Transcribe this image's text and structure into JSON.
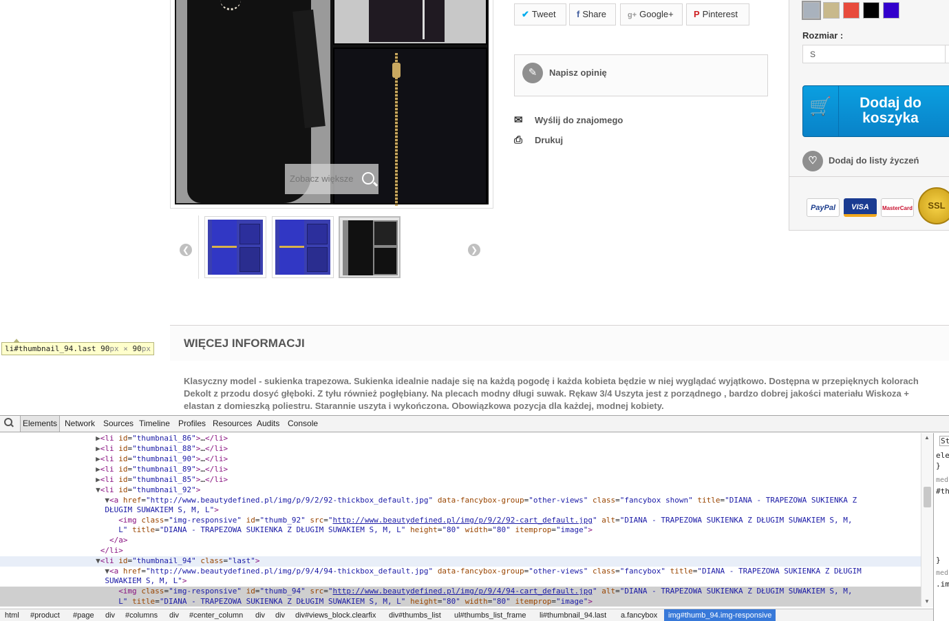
{
  "product": {
    "zoom_label": "Zobacz większe",
    "thumb_prev": "❮",
    "thumb_next": "❯",
    "share": [
      {
        "icon": "twitter-icon",
        "glyph": "🐦",
        "label": "Tweet"
      },
      {
        "icon": "facebook-icon",
        "glyph": "f",
        "label": "Share"
      },
      {
        "icon": "google-plus-icon",
        "glyph": "g+",
        "label": "Google+"
      },
      {
        "icon": "pinterest-icon",
        "glyph": "P",
        "label": "Pinterest"
      }
    ],
    "write_review": "Napisz opinię",
    "send_friend": "Wyślij do znajomego",
    "print": "Drukuj",
    "size_label": "Rozmiar :",
    "size_value": "S",
    "add_to_cart": "Dodaj do koszyka",
    "wishlist": "Dodaj do listy życzeń",
    "swatches": [
      "#a9b2bd",
      "#c8b98c",
      "#e84b3c",
      "#000000",
      "#3300cc"
    ],
    "payment": [
      "PayPal",
      "VISA",
      "MasterCard"
    ],
    "ssl": "SSL",
    "more_info_title": "WIĘCEJ INFORMACJI",
    "description": "Klasyczny model - sukienka trapezowa. Sukienka idealnie nadaje się na każdą pogodę i każda kobieta będzie w niej wyglądać wyjątkowo. Dostępna w przepięknych kolorach\nDekolt z przodu dosyć głęboki. Z tyłu również pogłębiany. Na plecach modny długi suwak. Rękaw 3/4 Uszyta jest z porządnego , bardzo dobrej jakości materiału Wiskoza +\nelastan z domieszką poliestru. Starannie uszyta i wykończona. Obowiązkowa pozycja dla każdej, modnej kobiety."
  },
  "tooltip": {
    "selector": "li#thumbnail_94.last",
    "w": "90",
    "h": "90",
    "unit": "px",
    "times": "×"
  },
  "devtools": {
    "tabs": [
      "Elements",
      "Network",
      "Sources",
      "Timeline",
      "Profiles",
      "Resources",
      "Audits",
      "Console"
    ],
    "breadcrumbs": [
      "html",
      "#product",
      "#page",
      "div",
      "#columns",
      "div",
      "#center_column",
      "div",
      "div",
      "div#views_block.clearfix",
      "div#thumbs_list",
      "ul#thumbs_list_frame",
      "li#thumbnail_94.last",
      "a.fancybox",
      "img#thumb_94.img-responsive"
    ],
    "styles_pane": [
      "St",
      "ele",
      "}",
      "med",
      "#th",
      "}",
      "med",
      ".im"
    ]
  }
}
